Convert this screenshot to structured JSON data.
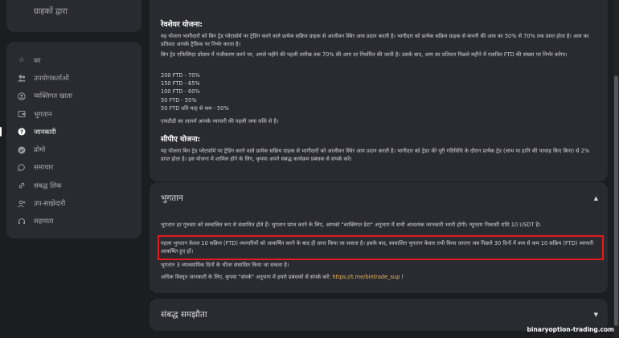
{
  "sidebar": {
    "top_item": "ग्राहकों द्वारा",
    "items": [
      {
        "label": "घर",
        "icon": "star-icon"
      },
      {
        "label": "उपयोगकर्ताओं",
        "icon": "users-icon"
      },
      {
        "label": "व्यक्तिगत खाता",
        "icon": "account-icon"
      },
      {
        "label": "भुगतान",
        "icon": "wallet-icon"
      },
      {
        "label": "जानकारी",
        "icon": "info-icon"
      },
      {
        "label": "प्रोमो",
        "icon": "promo-icon"
      },
      {
        "label": "समाचार",
        "icon": "news-icon"
      },
      {
        "label": "संबद्ध लिंक",
        "icon": "link-icon"
      },
      {
        "label": "उप-साझेदारी",
        "icon": "add-user-icon"
      },
      {
        "label": "सहायता",
        "icon": "headset-icon"
      }
    ],
    "active_index": 4
  },
  "revshare": {
    "title": "रेवशेयर योजना:",
    "p1": "यह योजना भागीदारों को बिन ट्रेड प्लेटफ़ॉर्म पर ट्रेडिंग करने वाले प्रत्येक सक्रिय ग्राहक से आजीवन स्थिर आय प्रदान करती है। भागीदार को प्रत्येक सक्रिय ग्राहक से कंपनी की आय का 50% से 70% तक प्राप्त होता है। आय का प्रतिशत आपके ट्रैफ़िक पर निर्भर करता है।",
    "p2": "बिन ट्रेड एफिलिएट प्रोग्राम में पंजीकरण करने पर, अगले महीने की पहली तारीख तक 70% की आय दर निर्धारित की जाती है। उसके बाद, आय का प्रतिशत पिछले महीने में एकत्रित FTD की संख्या पर निर्भर करेगा।",
    "tiers": [
      "200 FTD - 70%",
      "150 FTD - 65%",
      "100 FTD - 60%",
      "50 FTD - 55%",
      "50 FTD प्रति माह से कम - 50%"
    ],
    "note": "एफटीडी का तात्पर्य आपके व्यापारी की पहली जमा राशि से है।"
  },
  "cpa": {
    "title": "सीपीए योजना:",
    "p1": "यह योजना बिन ट्रेड प्लेटफ़ॉर्म पर ट्रेडिंग करने वाले प्रत्येक सक्रिय ग्राहक से भागीदारों को आजीवन स्थिर आय प्रदान करती है। भागीदार को ट्रेडर की पूरी गतिविधि के दौरान प्रत्येक ट्रेड (लाभ या हानि की परवाह किए बिना) से 2% प्राप्त होता है। इस योजना में शामिल होने के लिए, कृपया अपने संबद्ध कार्यक्रम प्रबंधक से संपर्क करें।"
  },
  "payment": {
    "title": "भुगतान",
    "p1": "भुगतान हर गुरुवार को स्वचालित रूप से संसाधित होते हैं। भुगतान प्राप्त करने के लिए, आपको \"व्यक्तिगत डेटा\" अनुभाग में सभी आवश्यक जानकारी भरनी होगी। न्यूनतम निकासी राशि 10 USDT है।",
    "p2": "पहला भुगतान केवल 10 सक्रिय (FTD) व्यापारियों को आकर्षित करने के बाद ही प्राप्त किया जा सकता है। इसके बाद, स्वचालित भुगतान केवल तभी किया जाएगा जब पिछले 30 दिनों में कम से कम 10 सक्रिय (FTD) व्यापारी आकर्षित हुए हों।",
    "p3": "भुगतान 3 व्यावसायिक दिनों के भीतर संसाधित किया जा सकता है।",
    "p4_prefix": "अधिक विस्तृत जानकारी के लिए, कृपया \"संपर्क\" अनुभाग में हमारे प्रबंधकों से संपर्क करें: ",
    "p4_link": "https://t.me/bintrade_sup",
    "p4_suffix": " !",
    "chevron": "▲"
  },
  "agreement": {
    "title": "संबद्ध समझौता",
    "chevron": "▼"
  },
  "watermark": "binaryoption-trading.com",
  "colors": {
    "highlight": "#e01b1b",
    "link": "#e8b75a",
    "card": "#2a2b30"
  }
}
